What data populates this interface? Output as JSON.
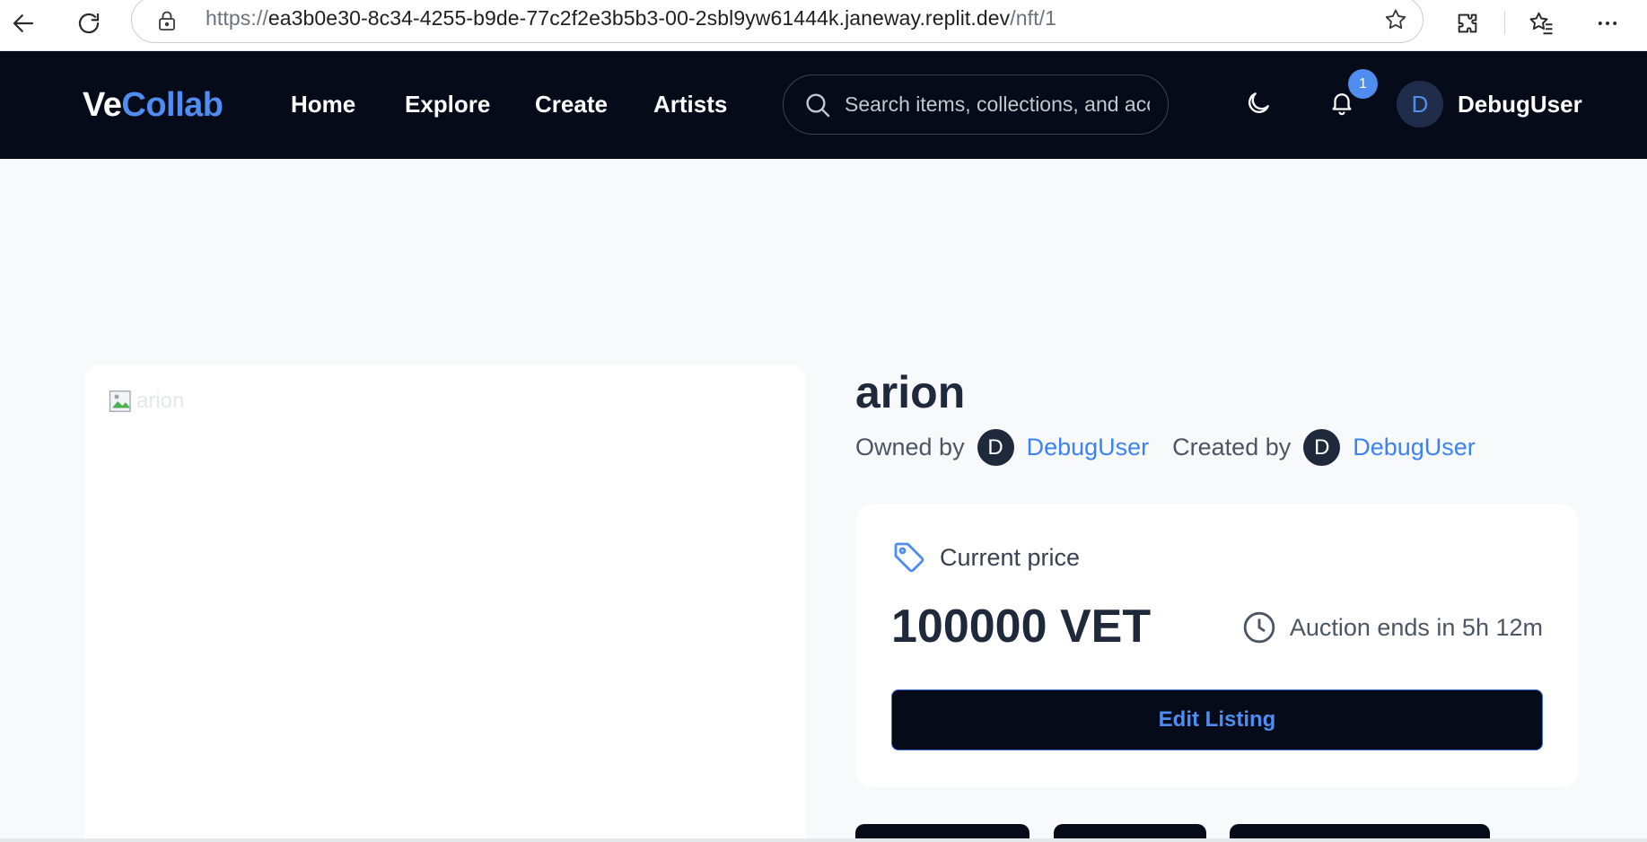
{
  "browser": {
    "url_prefix": "https://",
    "url_host": "ea3b0e30-8c34-4255-b9de-77c2f2e3b5b3-00-2sbl9yw61444k.janeway.replit.dev",
    "url_path": "/nft/1"
  },
  "header": {
    "logo_part1": "Ve",
    "logo_part2": "Collab",
    "nav": [
      "Home",
      "Explore",
      "Create",
      "Artists"
    ],
    "search_placeholder": "Search items, collections, and accounts",
    "notification_count": "1",
    "user_initial": "D",
    "user_name": "DebugUser"
  },
  "nft": {
    "image_alt": "arion",
    "title": "arion",
    "owned_by_label": "Owned by",
    "owner_initial": "D",
    "owner_name": "DebugUser",
    "created_by_label": "Created by",
    "creator_initial": "D",
    "creator_name": "DebugUser"
  },
  "price": {
    "label": "Current price",
    "value": "100000 VET",
    "auction_text": "Auction ends in 5h 12m",
    "edit_button": "Edit Listing"
  },
  "colors": {
    "header_bg": "#060b1a",
    "accent": "#4f8df0",
    "page_bg": "#f8f9fb"
  },
  "icons": [
    "back-icon",
    "refresh-icon",
    "lock-icon",
    "star-icon",
    "extensions-icon",
    "favorites-icon",
    "more-icon",
    "search-icon",
    "moon-icon",
    "bell-icon",
    "tag-icon",
    "clock-icon",
    "broken-image-icon"
  ]
}
